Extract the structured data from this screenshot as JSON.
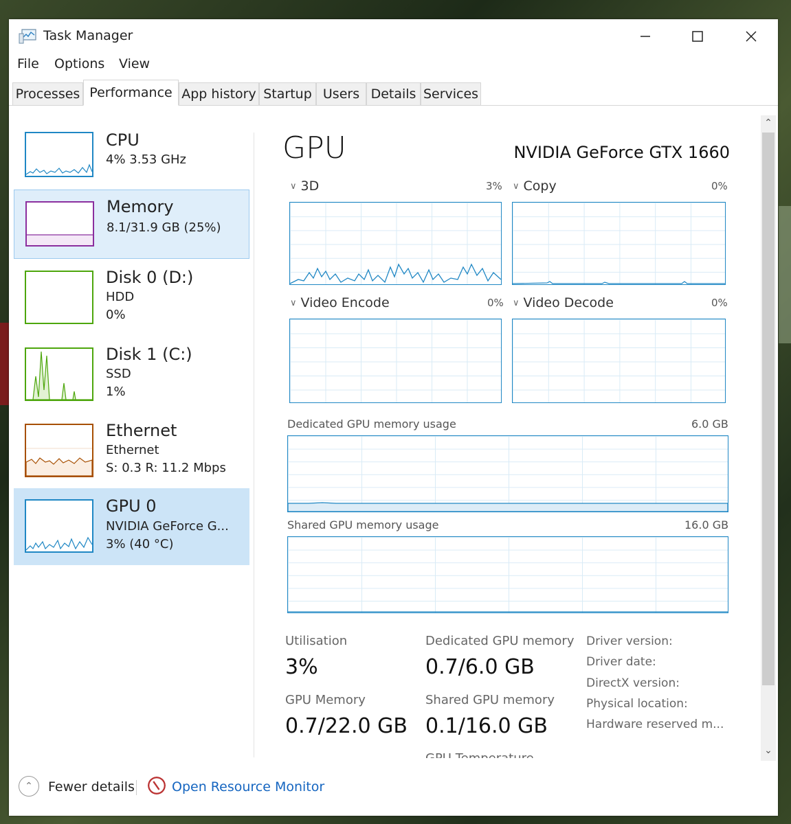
{
  "window": {
    "title": "Task Manager"
  },
  "menu": [
    "File",
    "Options",
    "View"
  ],
  "tabs": [
    "Processes",
    "Performance",
    "App history",
    "Startup",
    "Users",
    "Details",
    "Services"
  ],
  "sidebar": [
    {
      "title": "CPU",
      "line1": "4% 3.53 GHz",
      "line2": "",
      "color": "#1f87c4"
    },
    {
      "title": "Memory",
      "line1": "8.1/31.9 GB (25%)",
      "line2": "",
      "color": "#8b2e9e"
    },
    {
      "title": "Disk 0 (D:)",
      "line1": "HDD",
      "line2": "0%",
      "color": "#4da60c"
    },
    {
      "title": "Disk 1 (C:)",
      "line1": "SSD",
      "line2": "1%",
      "color": "#4da60c"
    },
    {
      "title": "Ethernet",
      "line1": "Ethernet",
      "line2": "S: 0.3  R: 11.2 Mbps",
      "color": "#a74f01"
    },
    {
      "title": "GPU 0",
      "line1": "NVIDIA GeForce G...",
      "line2": "3% (40 °C)",
      "color": "#1f87c4"
    }
  ],
  "gpu": {
    "heading": "GPU",
    "model": "NVIDIA GeForce GTX 1660",
    "engines": [
      {
        "name": "3D",
        "pct": "3%"
      },
      {
        "name": "Copy",
        "pct": "0%"
      },
      {
        "name": "Video Encode",
        "pct": "0%"
      },
      {
        "name": "Video Decode",
        "pct": "0%"
      }
    ],
    "dedicated_label": "Dedicated GPU memory usage",
    "dedicated_max": "6.0 GB",
    "shared_label": "Shared GPU memory usage",
    "shared_max": "16.0 GB",
    "stats": {
      "utilisation_label": "Utilisation",
      "utilisation_value": "3%",
      "dedicated_label": "Dedicated GPU memory",
      "dedicated_value": "0.7/6.0 GB",
      "gpu_memory_label": "GPU Memory",
      "gpu_memory_value": "0.7/22.0 GB",
      "shared_label": "Shared GPU memory",
      "shared_value": "0.1/16.0 GB",
      "temp_label": "GPU Temperature"
    },
    "info": [
      "Driver version:",
      "Driver date:",
      "DirectX version:",
      "Physical location:",
      "Hardware reserved m..."
    ]
  },
  "footer": {
    "fewer_details": "Fewer details",
    "open_resource_monitor": "Open Resource Monitor"
  }
}
